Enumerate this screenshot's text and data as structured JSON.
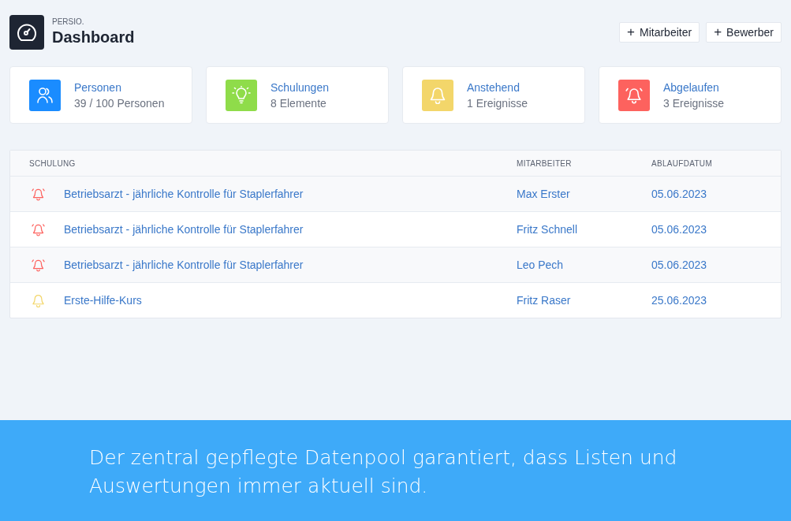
{
  "header": {
    "brand": "PERSIO.",
    "title": "Dashboard",
    "buttons": [
      {
        "icon": "+",
        "label": "Mitarbeiter"
      },
      {
        "icon": "+",
        "label": "Bewerber"
      }
    ]
  },
  "stats": [
    {
      "kind": "people",
      "color": "#1a8cff",
      "title": "Personen",
      "value": "39 / 100 Personen"
    },
    {
      "kind": "bulb",
      "color": "#8fdc4a",
      "title": "Schulungen",
      "value": "8 Elemente"
    },
    {
      "kind": "bell",
      "color": "#f3d66a",
      "title": "Anstehend",
      "value": "1 Ereignisse"
    },
    {
      "kind": "bell-ring",
      "color": "#fd625e",
      "title": "Abgelaufen",
      "value": "3 Ereignisse"
    }
  ],
  "table": {
    "columns": [
      "SCHULUNG",
      "MITARBEITER",
      "ABLAUFDATUM"
    ],
    "rows": [
      {
        "kind": "expired",
        "training": "Betriebsarzt - jährliche Kontrolle für Staplerfahrer",
        "employee": "Max Erster",
        "date": "05.06.2023"
      },
      {
        "kind": "expired",
        "training": "Betriebsarzt - jährliche Kontrolle für Staplerfahrer",
        "employee": "Fritz Schnell",
        "date": "05.06.2023"
      },
      {
        "kind": "expired",
        "training": "Betriebsarzt - jährliche Kontrolle für Staplerfahrer",
        "employee": "Leo Pech",
        "date": "05.06.2023"
      },
      {
        "kind": "pending",
        "training": "Erste-Hilfe-Kurs",
        "employee": "Fritz Raser",
        "date": "25.06.2023"
      }
    ]
  },
  "banner": {
    "text": "Der zentral gepflegte Datenpool garantiert, dass Listen und Auswertungen immer aktuell sind."
  }
}
